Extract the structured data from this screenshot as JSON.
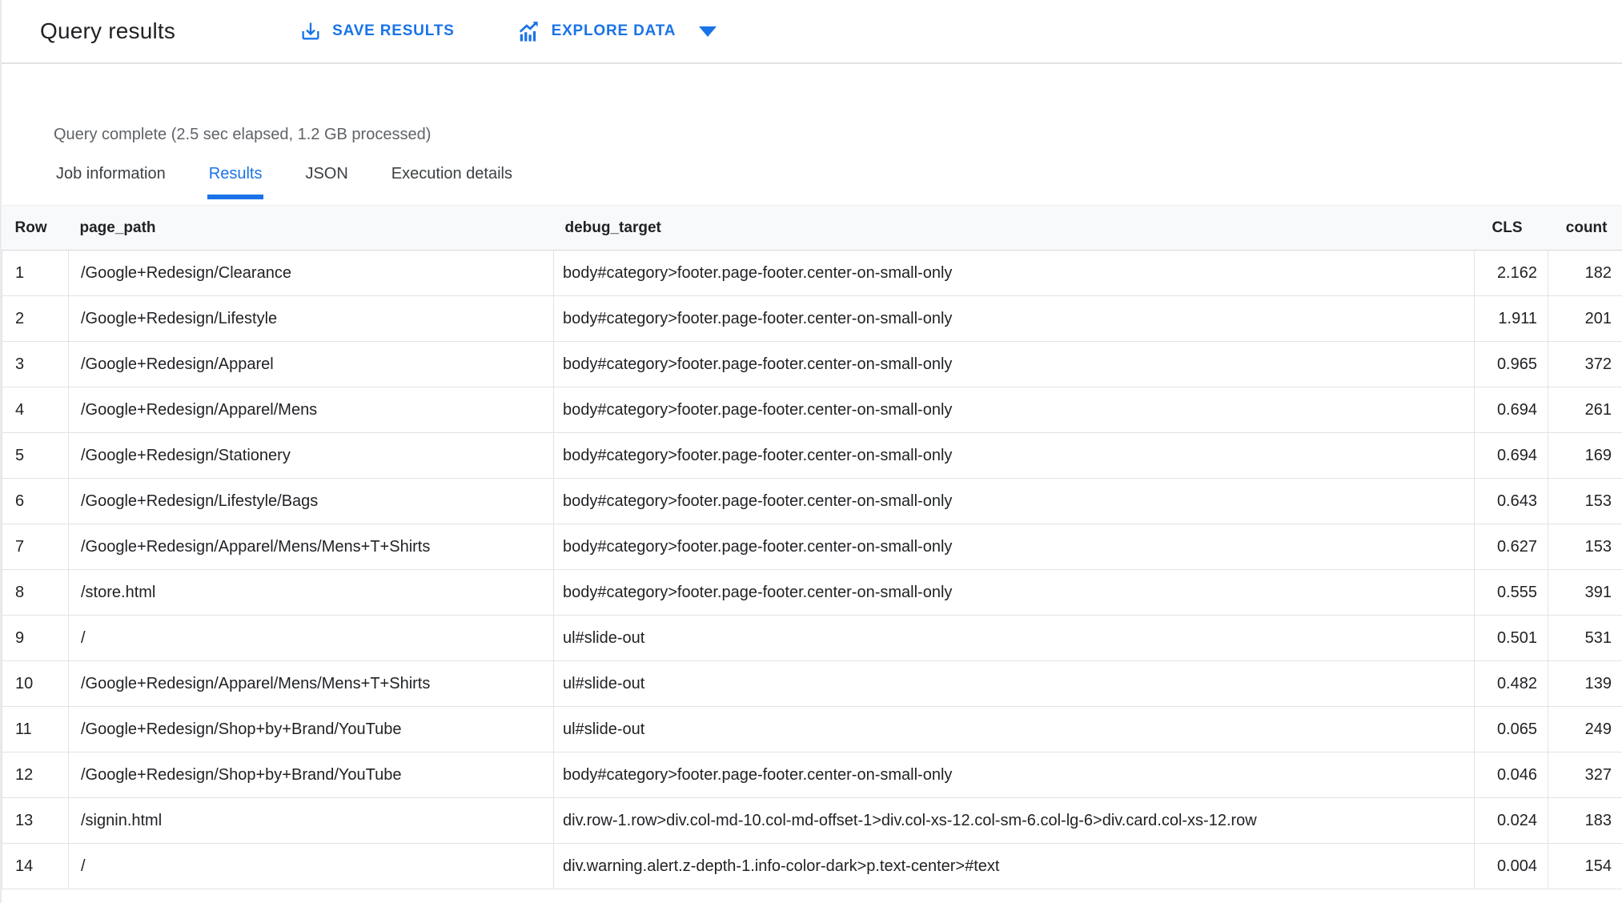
{
  "header": {
    "title": "Query results",
    "save_label": "SAVE RESULTS",
    "explore_label": "EXPLORE DATA",
    "icons": [
      "download-icon",
      "explore-chart-icon",
      "caret-down-icon"
    ],
    "accent_color": "#1a73e8"
  },
  "status_text": "Query complete (2.5 sec elapsed, 1.2 GB processed)",
  "tabs": [
    {
      "label": "Job information",
      "active": false
    },
    {
      "label": "Results",
      "active": true
    },
    {
      "label": "JSON",
      "active": false
    },
    {
      "label": "Execution details",
      "active": false
    }
  ],
  "results_table": {
    "columns": [
      "Row",
      "page_path",
      "debug_target",
      "CLS",
      "count"
    ],
    "rows": [
      {
        "row": "1",
        "page_path": "/Google+Redesign/Clearance",
        "debug_target": "body#category>footer.page-footer.center-on-small-only",
        "cls": "2.162",
        "count": "182"
      },
      {
        "row": "2",
        "page_path": "/Google+Redesign/Lifestyle",
        "debug_target": "body#category>footer.page-footer.center-on-small-only",
        "cls": "1.911",
        "count": "201"
      },
      {
        "row": "3",
        "page_path": "/Google+Redesign/Apparel",
        "debug_target": "body#category>footer.page-footer.center-on-small-only",
        "cls": "0.965",
        "count": "372"
      },
      {
        "row": "4",
        "page_path": "/Google+Redesign/Apparel/Mens",
        "debug_target": "body#category>footer.page-footer.center-on-small-only",
        "cls": "0.694",
        "count": "261"
      },
      {
        "row": "5",
        "page_path": "/Google+Redesign/Stationery",
        "debug_target": "body#category>footer.page-footer.center-on-small-only",
        "cls": "0.694",
        "count": "169"
      },
      {
        "row": "6",
        "page_path": "/Google+Redesign/Lifestyle/Bags",
        "debug_target": "body#category>footer.page-footer.center-on-small-only",
        "cls": "0.643",
        "count": "153"
      },
      {
        "row": "7",
        "page_path": "/Google+Redesign/Apparel/Mens/Mens+T+Shirts",
        "debug_target": "body#category>footer.page-footer.center-on-small-only",
        "cls": "0.627",
        "count": "153"
      },
      {
        "row": "8",
        "page_path": "/store.html",
        "debug_target": "body#category>footer.page-footer.center-on-small-only",
        "cls": "0.555",
        "count": "391"
      },
      {
        "row": "9",
        "page_path": "/",
        "debug_target": "ul#slide-out",
        "cls": "0.501",
        "count": "531"
      },
      {
        "row": "10",
        "page_path": "/Google+Redesign/Apparel/Mens/Mens+T+Shirts",
        "debug_target": "ul#slide-out",
        "cls": "0.482",
        "count": "139"
      },
      {
        "row": "11",
        "page_path": "/Google+Redesign/Shop+by+Brand/YouTube",
        "debug_target": "ul#slide-out",
        "cls": "0.065",
        "count": "249"
      },
      {
        "row": "12",
        "page_path": "/Google+Redesign/Shop+by+Brand/YouTube",
        "debug_target": "body#category>footer.page-footer.center-on-small-only",
        "cls": "0.046",
        "count": "327"
      },
      {
        "row": "13",
        "page_path": "/signin.html",
        "debug_target": "div.row-1.row>div.col-md-10.col-md-offset-1>div.col-xs-12.col-sm-6.col-lg-6>div.card.col-xs-12.row",
        "cls": "0.024",
        "count": "183"
      },
      {
        "row": "14",
        "page_path": "/",
        "debug_target": "div.warning.alert.z-depth-1.info-color-dark>p.text-center>#text",
        "cls": "0.004",
        "count": "154"
      }
    ]
  }
}
